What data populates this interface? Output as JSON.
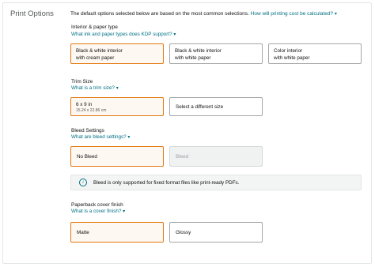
{
  "section_title": "Print Options",
  "intro": {
    "text": "The default options selected below are based on the most common selections.",
    "link": "How will printing cost be calculated?"
  },
  "interior": {
    "label": "Interior & paper type",
    "help": "What ink and paper types does KDP support?",
    "options": [
      {
        "line1": "Black & white interior",
        "line2": "with cream paper"
      },
      {
        "line1": "Black & white interior",
        "line2": "with white paper"
      },
      {
        "line1": "Color interior",
        "line2": "with white paper"
      }
    ]
  },
  "trim": {
    "label": "Trim Size",
    "help": "What is a trim size?",
    "selected_main": "6 x 9 in",
    "selected_sub": "15.24 x 22.86 cm",
    "other": "Select a different size"
  },
  "bleed": {
    "label": "Bleed Settings",
    "help": "What are bleed settings?",
    "options": [
      "No Bleed",
      "Bleed"
    ],
    "info": "Bleed is only supported for fixed format files like print-ready PDFs."
  },
  "cover": {
    "label": "Paperback cover finish",
    "help": "What is a cover finish?",
    "options": [
      "Matte",
      "Glossy"
    ]
  },
  "icons": {
    "caret": "chevron-down-icon",
    "info": "info-icon"
  },
  "colors": {
    "link": "#007185",
    "selected_border": "#e47911",
    "selected_bg": "#fef8f2"
  }
}
